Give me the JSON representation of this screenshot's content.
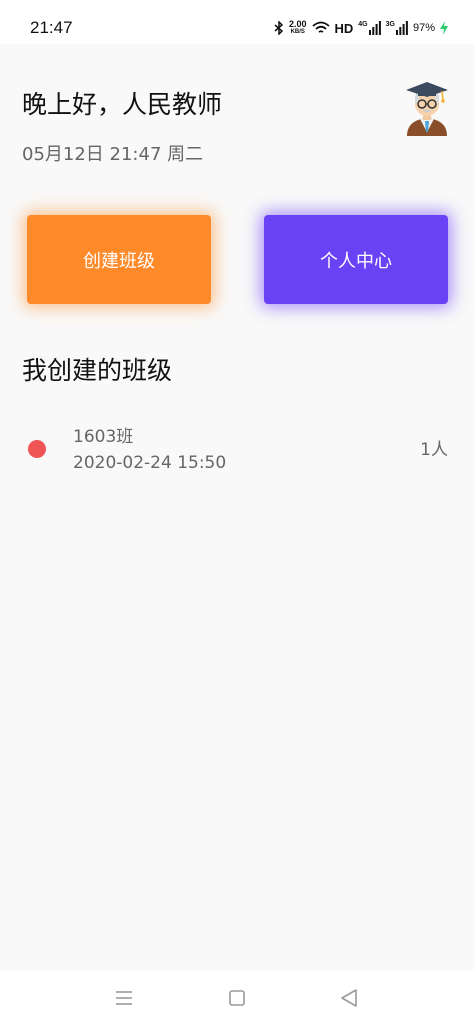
{
  "status_bar": {
    "time": "21:47",
    "net_speed_value": "2.00",
    "net_speed_unit": "KB/S",
    "hd_label": "HD",
    "signal_1_label": "4G",
    "signal_2_label": "3G",
    "battery": "97%",
    "icons": [
      "bluetooth-icon",
      "wifi-icon",
      "signal-icon",
      "charging-icon"
    ]
  },
  "header": {
    "greeting": "晚上好，人民教师",
    "date": "05月12日 21:47 周二",
    "avatar_icon": "teacher-avatar-icon"
  },
  "actions": {
    "create_class_label": "创建班级",
    "profile_label": "个人中心",
    "create_color": "#ff8a2a",
    "profile_color": "#6a42f6"
  },
  "classes": {
    "title": "我创建的班级",
    "items": [
      {
        "name": "1603班",
        "created": "2020-02-24 15:50",
        "count": "1人",
        "dot_color": "#f05556"
      }
    ]
  },
  "nav_bar": {
    "icons": [
      "menu-icon",
      "home-icon",
      "back-icon"
    ]
  }
}
